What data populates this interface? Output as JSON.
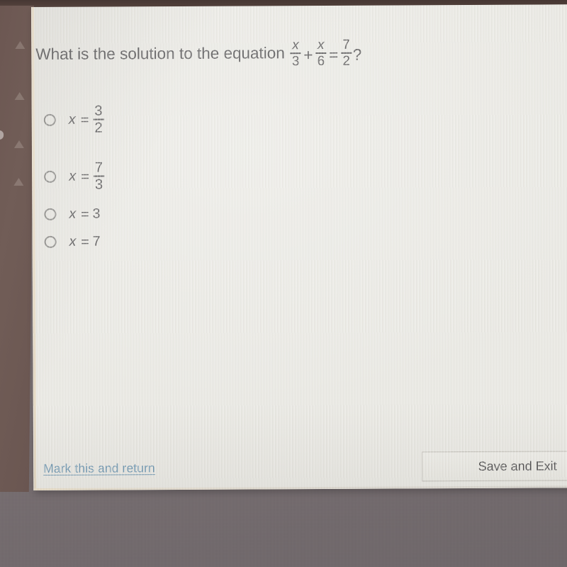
{
  "page": {
    "background_color": "#eae9e3",
    "photo_background_color": "#7b7275",
    "left_strip_color": "#6c5752"
  },
  "question": {
    "prefix": "What is the solution to the equation",
    "equation": {
      "term1": {
        "numerator": "x",
        "denominator": "3"
      },
      "operator": "+",
      "term2": {
        "numerator": "x",
        "denominator": "6"
      },
      "equals": "=",
      "result": {
        "numerator": "7",
        "denominator": "2"
      },
      "trailing": "?"
    },
    "full_text": "What is the solution to the equation x/3 + x/6 = 7/2?"
  },
  "options": [
    {
      "id": "option-0",
      "variable": "x",
      "equals": "=",
      "value_type": "fraction",
      "numerator": "3",
      "denominator": "2",
      "value_text": "3/2",
      "label": "x = 3/2",
      "selected": false
    },
    {
      "id": "option-1",
      "variable": "x",
      "equals": "=",
      "value_type": "fraction",
      "numerator": "7",
      "denominator": "3",
      "value_text": "7/3",
      "label": "x = 7/3",
      "selected": false
    },
    {
      "id": "option-2",
      "variable": "x",
      "equals": "=",
      "value_type": "integer",
      "value_text": "3",
      "label": "x = 3",
      "selected": false
    },
    {
      "id": "option-3",
      "variable": "x",
      "equals": "=",
      "value_type": "integer",
      "value_text": "7",
      "label": "x = 7",
      "selected": false
    }
  ],
  "footer": {
    "mark_link_label": "Mark this and return",
    "mark_link_color": "#5e8cab",
    "save_button_label": "Save and Exit"
  }
}
